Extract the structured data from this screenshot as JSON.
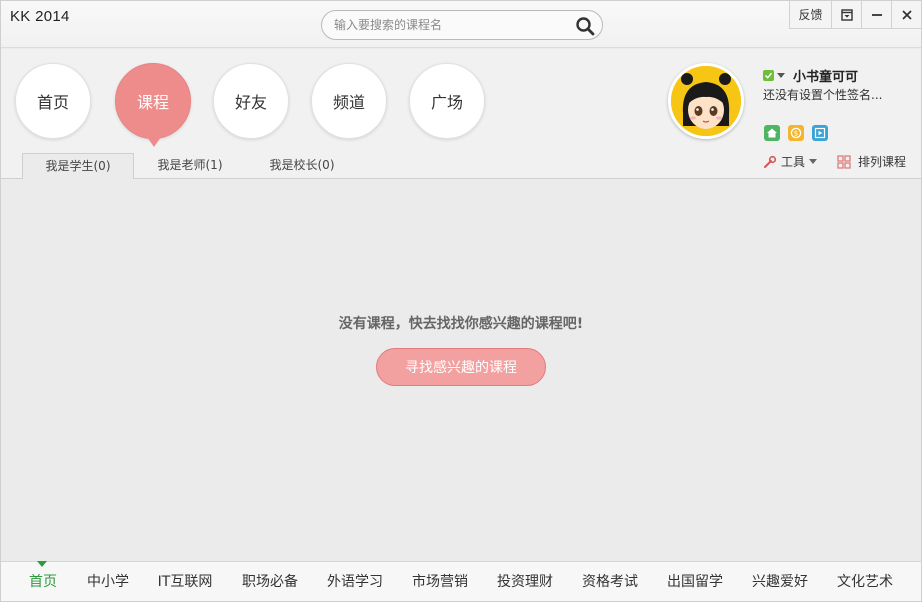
{
  "app": {
    "title": "KK 2014"
  },
  "search": {
    "placeholder": "输入要搜索的课程名"
  },
  "window_controls": {
    "feedback": "反馈"
  },
  "nav": [
    {
      "label": "首页"
    },
    {
      "label": "课程",
      "active": true
    },
    {
      "label": "好友"
    },
    {
      "label": "频道"
    },
    {
      "label": "广场"
    }
  ],
  "tabs": [
    {
      "label": "我是学生(0)",
      "active": true
    },
    {
      "label": "我是老师(1)"
    },
    {
      "label": "我是校长(0)"
    }
  ],
  "user": {
    "name": "小书童可可",
    "signature": "还没有设置个性签名...",
    "status_color": "#6fbe3a"
  },
  "tools": {
    "tools_label": "工具",
    "sort_label": "排列课程"
  },
  "content": {
    "empty_message": "没有课程，快去找找你感兴趣的课程吧!",
    "find_button": "寻找感兴趣的课程"
  },
  "categories": [
    {
      "label": "首页",
      "active": true
    },
    {
      "label": "中小学"
    },
    {
      "label": "IT互联网"
    },
    {
      "label": "职场必备"
    },
    {
      "label": "外语学习"
    },
    {
      "label": "市场营销"
    },
    {
      "label": "投资理财"
    },
    {
      "label": "资格考试"
    },
    {
      "label": "出国留学"
    },
    {
      "label": "兴趣爱好"
    },
    {
      "label": "文化艺术"
    }
  ],
  "colors": {
    "accent": "#ee8c8c",
    "category_active": "#2e9a3d"
  }
}
